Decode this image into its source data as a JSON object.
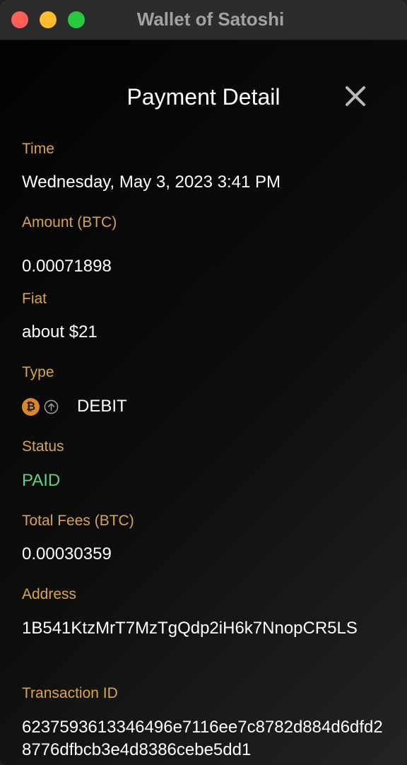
{
  "window": {
    "title": "Wallet of Satoshi"
  },
  "page": {
    "title": "Payment Detail"
  },
  "details": {
    "time_label": "Time",
    "time_value": "Wednesday, May 3, 2023 3:41 PM",
    "amount_label": "Amount (BTC)",
    "amount_value": "0.00071898",
    "fiat_label": "Fiat",
    "fiat_value": "about $21",
    "type_label": "Type",
    "type_value": "DEBIT",
    "status_label": "Status",
    "status_value": "PAID",
    "fees_label": "Total Fees (BTC)",
    "fees_value": "0.00030359",
    "address_label": "Address",
    "address_value": "1B541KtzMrT7MzTgQdp2iH6k7NnopCR5LS",
    "txid_label": "Transaction ID",
    "txid_value": "6237593613346496e7116ee7c8782d884d6dfd28776dfbcb3e4d8386cebe5dd1"
  },
  "icons": {
    "close": "close-icon",
    "bitcoin": "bitcoin-icon",
    "arrow_up": "arrow-up-circle-icon"
  },
  "colors": {
    "label": "#d9a44e",
    "value": "#ffffff",
    "status_paid": "#61d37a",
    "bitcoin": "#d9852b",
    "window_close": "#fe5f57",
    "window_minimize": "#febc2e",
    "window_maximize": "#28c840"
  }
}
